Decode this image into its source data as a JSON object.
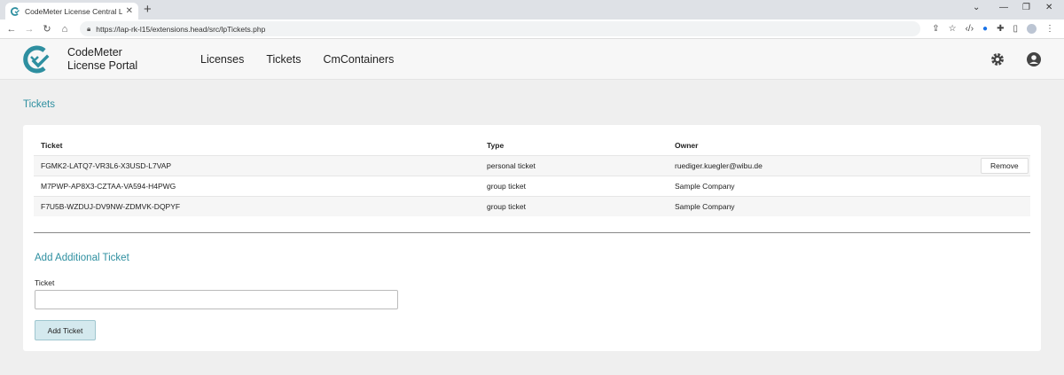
{
  "browser": {
    "tab_title": "CodeMeter License Central Licen",
    "url": "https://lap-rk-l15/extensions.head/src/lpTickets.php",
    "accent": "#1a73e8"
  },
  "app": {
    "brand_line1": "CodeMeter",
    "brand_line2": "License Portal",
    "nav": [
      "Licenses",
      "Tickets",
      "CmContainers"
    ],
    "brand_color": "#2e8fa0"
  },
  "page": {
    "title": "Tickets",
    "table": {
      "headers": [
        "Ticket",
        "Type",
        "Owner"
      ],
      "rows": [
        {
          "ticket": "FGMK2-LATQ7-VR3L6-X3USD-L7VAP",
          "type": "personal ticket",
          "owner": "ruediger.kuegler@wibu.de",
          "action": "Remove"
        },
        {
          "ticket": "M7PWP-AP8X3-CZTAA-VA594-H4PWG",
          "type": "group ticket",
          "owner": "Sample Company",
          "action": ""
        },
        {
          "ticket": "F7U5B-WZDUJ-DV9NW-ZDMVK-DQPYF",
          "type": "group ticket",
          "owner": "Sample Company",
          "action": ""
        }
      ]
    },
    "add_section": {
      "title": "Add Additional Ticket",
      "field_label": "Ticket",
      "field_value": "",
      "button_label": "Add Ticket"
    }
  }
}
